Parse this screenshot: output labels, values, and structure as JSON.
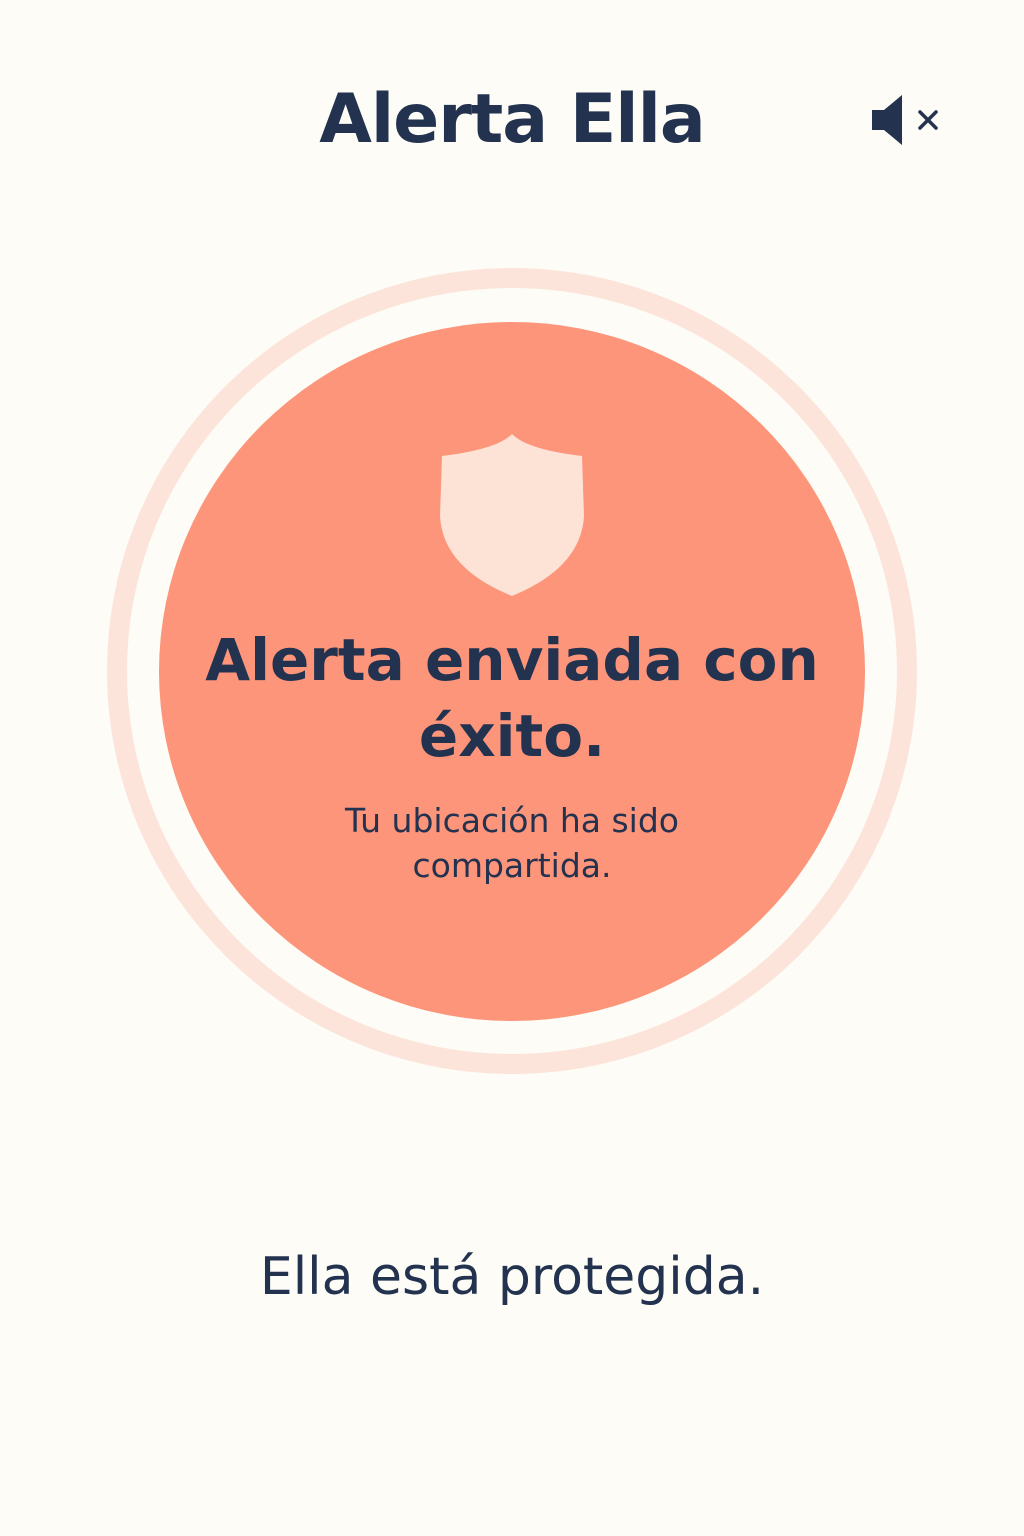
{
  "header": {
    "title": "Alerta Ella",
    "mute_icon": "speaker-muted-icon"
  },
  "alert": {
    "icon": "shield-icon",
    "title": "Alerta enviada con éxito.",
    "subtitle": "Tu ubicación ha sido compartida."
  },
  "footer": {
    "status": "Ella está protegida."
  },
  "colors": {
    "background": "#fdfcf6",
    "text": "#22324f",
    "alert_fill": "#fd957a",
    "ring": "#fde4da",
    "shield": "#fde2d6"
  }
}
